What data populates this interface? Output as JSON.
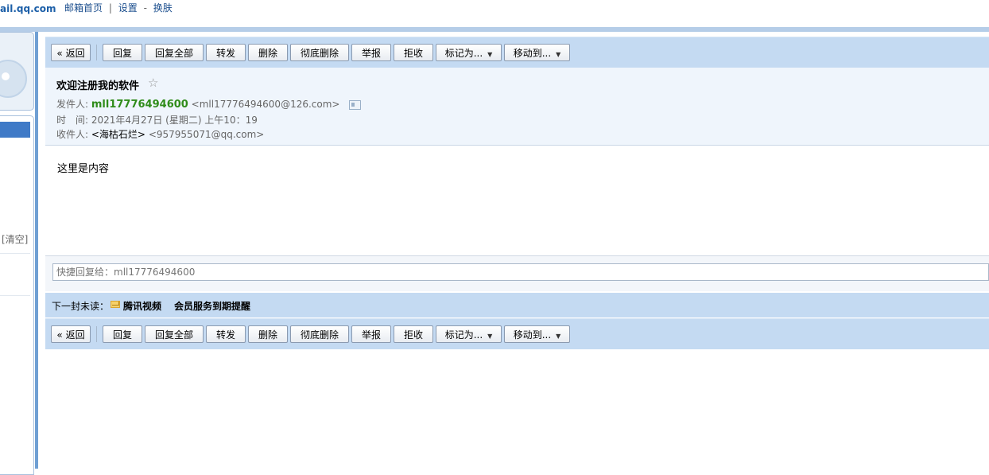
{
  "header": {
    "logo_domain": "ail.qq.com",
    "links": [
      "邮箱首页",
      "设置",
      "换肤"
    ],
    "separators": [
      "|",
      "-"
    ]
  },
  "sidebar": {
    "clear_label": "[清空]"
  },
  "toolbar": {
    "back": "« 返回",
    "reply": "回复",
    "reply_all": "回复全部",
    "forward": "转发",
    "delete": "删除",
    "delete_permanent": "彻底删除",
    "report": "举报",
    "reject": "拒收",
    "mark_as": "标记为...",
    "move_to": "移动到..."
  },
  "email": {
    "subject": "欢迎注册我的软件",
    "from_label": "发件人:",
    "sender_name": "mll17776494600",
    "sender_address": "<mll17776494600@126.com>",
    "time_label": "时　间:",
    "time_value": "2021年4月27日 (星期二) 上午10：19",
    "to_label": "收件人:",
    "recipient_name": "<海枯石烂>",
    "recipient_address": "<957955071@qq.com>",
    "body": "这里是内容"
  },
  "quick_reply": {
    "placeholder": "快捷回复给：mll17776494600"
  },
  "next_unread": {
    "label": "下一封未读：",
    "sender": "腾讯视频",
    "subject": "会员服务到期提醒"
  },
  "colors": {
    "toolbar_bg": "#c4daf2",
    "sender_green": "#2f8c1a",
    "border_blue": "#6f9fd3"
  }
}
